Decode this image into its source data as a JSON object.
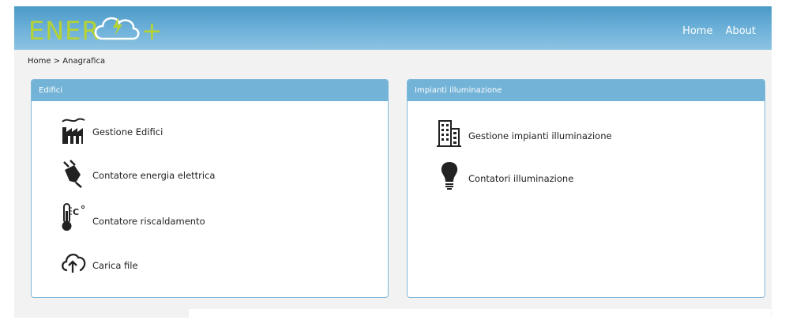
{
  "navbar": {
    "logo_text": "ENERCLOUD+",
    "links": [
      "Home",
      "About"
    ]
  },
  "breadcrumb": "Home > Anagrafica",
  "panels": [
    {
      "title": "Edifici",
      "items": [
        {
          "label": "Gestione Edifici",
          "icon": "factory-icon"
        },
        {
          "label": "Contatore energia elettrica",
          "icon": "plug-icon"
        },
        {
          "label": "Contatore riscaldamento",
          "icon": "thermometer-icon"
        },
        {
          "label": "Carica file",
          "icon": "cloud-upload-icon"
        }
      ]
    },
    {
      "title": "Impianti illuminazione",
      "items": [
        {
          "label": "Gestione impianti illuminazione",
          "icon": "building-icon"
        },
        {
          "label": "Contatori illuminazione",
          "icon": "lightbulb-icon"
        }
      ]
    }
  ],
  "colors": {
    "navbar": "#5aa6d1",
    "panel_header": "#73b3d7",
    "logo_green": "#b5d334",
    "background": "#f2f2f2"
  }
}
